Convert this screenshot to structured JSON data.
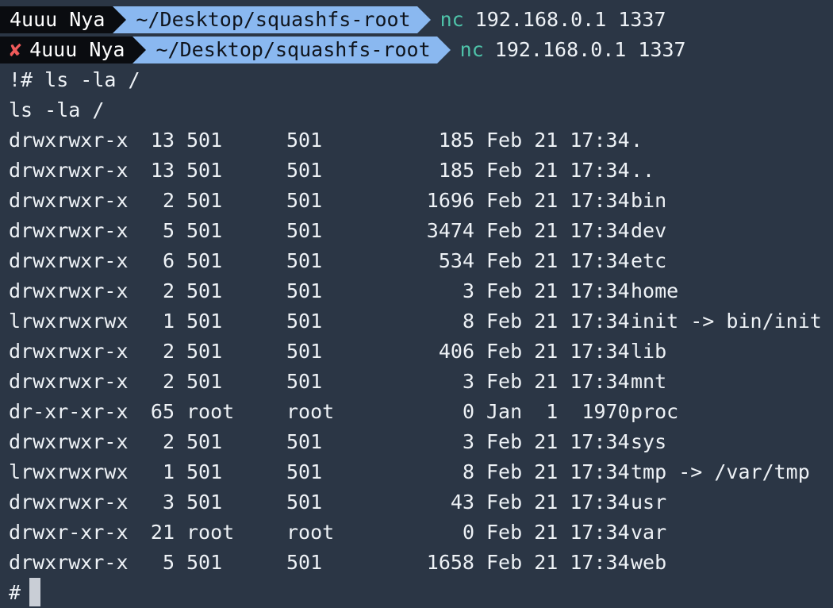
{
  "colors": {
    "background": "#2b3645",
    "prompt_user_bg": "#0a0c10",
    "prompt_path_bg": "#8ab8f0",
    "command_color": "#4ec2a8",
    "error_color": "#ef5a5a",
    "cursor_color": "#c9ced6"
  },
  "prompt1": {
    "user": "4uuu Nya",
    "path": "~/Desktop/squashfs-root",
    "command": "nc",
    "args": "192.168.0.1 1337"
  },
  "prompt2": {
    "error_icon": "✘",
    "user": "4uuu Nya",
    "path": "~/Desktop/squashfs-root",
    "command": "nc",
    "args": "192.168.0.1 1337"
  },
  "output": {
    "line1": "!# ls -la /",
    "line2": "ls -la /"
  },
  "listing": [
    {
      "perm": "drwxrwxr-x",
      "links": "13",
      "owner": "501",
      "group": "501",
      "size": "185",
      "date": "Feb 21 17:34",
      "name": "."
    },
    {
      "perm": "drwxrwxr-x",
      "links": "13",
      "owner": "501",
      "group": "501",
      "size": "185",
      "date": "Feb 21 17:34",
      "name": ".."
    },
    {
      "perm": "drwxrwxr-x",
      "links": "2",
      "owner": "501",
      "group": "501",
      "size": "1696",
      "date": "Feb 21 17:34",
      "name": "bin"
    },
    {
      "perm": "drwxrwxr-x",
      "links": "5",
      "owner": "501",
      "group": "501",
      "size": "3474",
      "date": "Feb 21 17:34",
      "name": "dev"
    },
    {
      "perm": "drwxrwxr-x",
      "links": "6",
      "owner": "501",
      "group": "501",
      "size": "534",
      "date": "Feb 21 17:34",
      "name": "etc"
    },
    {
      "perm": "drwxrwxr-x",
      "links": "2",
      "owner": "501",
      "group": "501",
      "size": "3",
      "date": "Feb 21 17:34",
      "name": "home"
    },
    {
      "perm": "lrwxrwxrwx",
      "links": "1",
      "owner": "501",
      "group": "501",
      "size": "8",
      "date": "Feb 21 17:34",
      "name": "init -> bin/init"
    },
    {
      "perm": "drwxrwxr-x",
      "links": "2",
      "owner": "501",
      "group": "501",
      "size": "406",
      "date": "Feb 21 17:34",
      "name": "lib"
    },
    {
      "perm": "drwxrwxr-x",
      "links": "2",
      "owner": "501",
      "group": "501",
      "size": "3",
      "date": "Feb 21 17:34",
      "name": "mnt"
    },
    {
      "perm": "dr-xr-xr-x",
      "links": "65",
      "owner": "root",
      "group": "root",
      "size": "0",
      "date": "Jan  1  1970",
      "name": "proc"
    },
    {
      "perm": "drwxrwxr-x",
      "links": "2",
      "owner": "501",
      "group": "501",
      "size": "3",
      "date": "Feb 21 17:34",
      "name": "sys"
    },
    {
      "perm": "lrwxrwxrwx",
      "links": "1",
      "owner": "501",
      "group": "501",
      "size": "8",
      "date": "Feb 21 17:34",
      "name": "tmp -> /var/tmp"
    },
    {
      "perm": "drwxrwxr-x",
      "links": "3",
      "owner": "501",
      "group": "501",
      "size": "43",
      "date": "Feb 21 17:34",
      "name": "usr"
    },
    {
      "perm": "drwxr-xr-x",
      "links": "21",
      "owner": "root",
      "group": "root",
      "size": "0",
      "date": "Feb 21 17:34",
      "name": "var"
    },
    {
      "perm": "drwxrwxr-x",
      "links": "5",
      "owner": "501",
      "group": "501",
      "size": "1658",
      "date": "Feb 21 17:34",
      "name": "web"
    }
  ],
  "final_prompt": "#"
}
